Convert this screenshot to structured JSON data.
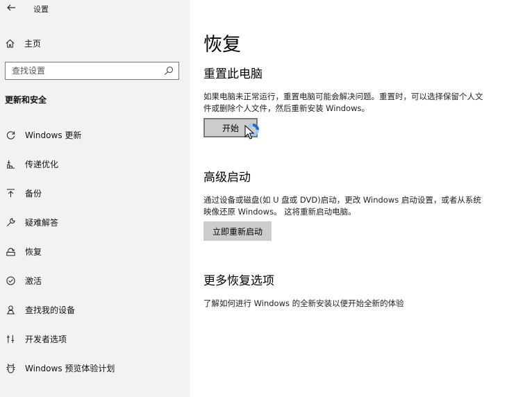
{
  "window": {
    "title": "设置"
  },
  "sidebar": {
    "home_label": "主页",
    "search_placeholder": "查找设置",
    "section_title": "更新和安全",
    "items": [
      {
        "label": "Windows 更新",
        "icon": "sync-icon"
      },
      {
        "label": "传递优化",
        "icon": "delivery-optimization-icon"
      },
      {
        "label": "备份",
        "icon": "backup-icon"
      },
      {
        "label": "疑难解答",
        "icon": "wrench-icon"
      },
      {
        "label": "恢复",
        "icon": "recovery-icon"
      },
      {
        "label": "激活",
        "icon": "activation-icon"
      },
      {
        "label": "查找我的设备",
        "icon": "find-device-icon"
      },
      {
        "label": "开发者选项",
        "icon": "developer-icon"
      },
      {
        "label": "Windows 预览体验计划",
        "icon": "insider-icon"
      }
    ]
  },
  "main": {
    "title": "恢复",
    "reset": {
      "heading": "重置此电脑",
      "description": "如果电脑未正常运行，重置电脑可能会解决问题。重置时，可以选择保留个人文件或删除个人文件，然后重新安装 Windows。",
      "button_label": "开始"
    },
    "advanced": {
      "heading": "高级启动",
      "description": "通过设备或磁盘(如 U 盘或 DVD)启动，更改 Windows 启动设置，或者从系统映像还原 Windows。 这将重新启动电脑。",
      "button_label": "立即重新启动"
    },
    "more": {
      "heading": "更多恢复选项",
      "link": "了解如何进行 Windows 的全新安装以便开始全新的体验"
    }
  }
}
